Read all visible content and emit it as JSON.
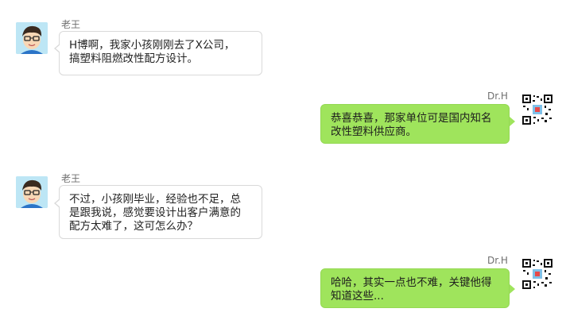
{
  "messages": [
    {
      "side": "left",
      "sender": "老王",
      "avatar_icon": "cartoon-boy-avatar-icon",
      "text": "H博啊，我家小孩刚刚去了X公司，\n搞塑料阻燃改性配方设计。"
    },
    {
      "side": "right",
      "sender": "Dr.H",
      "avatar_icon": "qr-code-avatar-icon",
      "text": "恭喜恭喜，那家单位可是国内知名\n改性塑料供应商。"
    },
    {
      "side": "left",
      "sender": "老王",
      "avatar_icon": "cartoon-boy-avatar-icon",
      "text": "不过，小孩刚毕业，经验也不足，总\n是跟我说，感觉要设计出客户满意的\n配方太难了，这可怎么办？"
    },
    {
      "side": "right",
      "sender": "Dr.H",
      "avatar_icon": "qr-code-avatar-icon",
      "text": "哈哈，其实一点也不难，关键他得\n知道这些..."
    }
  ],
  "colors": {
    "right_bubble": "#9fe45c",
    "left_bubble": "#ffffff",
    "left_border": "#d9d9d9"
  }
}
